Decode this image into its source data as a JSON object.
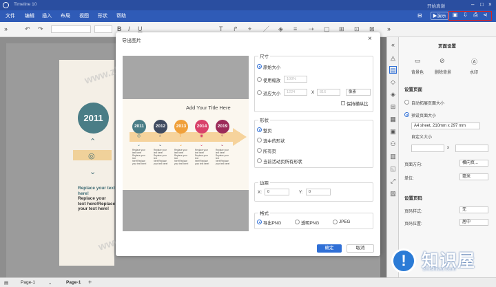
{
  "app": {
    "title": "Timeline 10",
    "user": "开始真谢"
  },
  "menu": {
    "items": [
      "文件",
      "编辑",
      "插入",
      "布局",
      "视图",
      "形状",
      "帮助"
    ],
    "present": "演示"
  },
  "colors": {
    "brand": "#2f5bb7",
    "highlight": "#e2211c",
    "primary": "#2f6fd6"
  },
  "poster": {
    "year": "2011",
    "text_teal": "Replace your text here!",
    "text_dark": "Replace your\ntext here!Replace\nyour text here!"
  },
  "dialog": {
    "title": "导出图片",
    "preview": {
      "heading": "Add Your Title Here",
      "years": [
        "2011",
        "2012",
        "2013",
        "2014",
        "2019"
      ],
      "year_colors": [
        "#4a7d86",
        "#3f4a5f",
        "#f0a03a",
        "#d9416a",
        "#9b2a58"
      ],
      "blurb": "Replace your\ntext here!\nReplace your\ntext here!Replace\nyour text here!"
    },
    "size": {
      "legend": "尺寸",
      "options": [
        "原始大小",
        "使用缩放",
        "适应大小"
      ],
      "selected": 0,
      "zoom_placeholder": "100%",
      "width_placeholder": "1224",
      "x_sep": "X",
      "height_placeholder": "816",
      "unit": "像素",
      "keep_ratio": "保持横纵比"
    },
    "shape": {
      "legend": "形状",
      "options": [
        "整页",
        "选中的形状",
        "所有页",
        "当前活动页所有形状"
      ],
      "selected": 0
    },
    "margin": {
      "legend": "边距",
      "x_label": "X:",
      "x_value": "0",
      "y_label": "Y:",
      "y_value": "0"
    },
    "format": {
      "legend": "格式",
      "options": [
        "导出PNG",
        "透明PNG",
        "JPEG"
      ],
      "selected": 0
    },
    "ok": "确定",
    "cancel": "取消"
  },
  "panel": {
    "title": "页面设置",
    "bg_buttons": [
      "背景色",
      "删除背景",
      "水印"
    ],
    "page_settings": "设置页面",
    "auto_expand": "自动拓展页面大小",
    "preset_size": "预设页面大小",
    "preset_value": "A4 sheet, 210mm x 297 mm",
    "custom_size": "自定义大小",
    "custom_x": "x",
    "orientation_label": "页面方向:",
    "orientation_value": "横向页...",
    "unit_label": "单位:",
    "unit_value": "毫米",
    "page_number": "设置页码",
    "style_label": "页码样式:",
    "style_value": "无",
    "position_label": "页码位置:",
    "position_value": "居中"
  },
  "bottom": {
    "pages": [
      "Page-1",
      "Page-1"
    ],
    "add": "+"
  },
  "watermark": {
    "text": "www.zhishiwu.com"
  },
  "logo": {
    "cn": "知识屋",
    "en": "zhishiwu.com"
  }
}
